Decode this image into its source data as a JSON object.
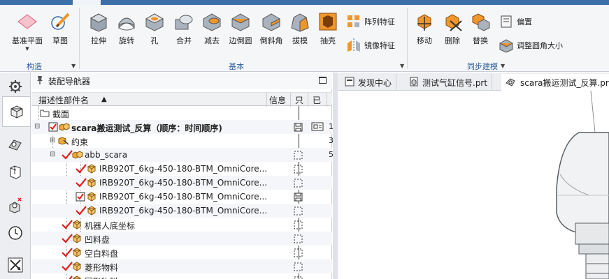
{
  "ribbon": {
    "groups": {
      "construct": "构造",
      "basic": "基本",
      "sync": "同步建模"
    },
    "buttons": {
      "datum_plane": "基准平面",
      "sketch": "草图",
      "extrude": "拉伸",
      "revolve": "旋转",
      "hole": "孔",
      "unite": "合并",
      "subtract": "减去",
      "edge_blend": "边倒圆",
      "chamfer": "倒斜角",
      "draft": "拔模",
      "shell": "抽壳",
      "pattern_feature": "阵列特征",
      "mirror_feature": "镜像特征",
      "move": "移动",
      "delete": "删除",
      "replace": "替换",
      "offset": "偏置",
      "resize_blend": "调整圆角大小"
    }
  },
  "navigator": {
    "title": "装配导航器",
    "columns": {
      "name": "描述性部件名",
      "sort_arrow": "▲",
      "info": "信息",
      "readonly": "只",
      "modified": "已"
    },
    "rows": [
      {
        "text": "截面",
        "bold": false,
        "icon": "folder-icon",
        "checked": null,
        "info": "",
        "col4": ""
      },
      {
        "text": "scara搬运测试_反算（顺序：时间顺序)",
        "bold": true,
        "icon": "assembly-icon",
        "checked": "box",
        "info": "save",
        "col3": "lock",
        "col4": "1"
      },
      {
        "text": "约束",
        "bold": false,
        "icon": "constraint-icon",
        "checked": null,
        "info": "",
        "col4": "3"
      },
      {
        "text": "abb_scara",
        "bold": false,
        "icon": "assembly-icon",
        "checked": "tick",
        "info": "dashed",
        "col4": "5"
      },
      {
        "text": "IRB920T_6kg-450-180-BTM_OmniCore...",
        "bold": false,
        "icon": "part-icon",
        "checked": "tick",
        "info": "dashed",
        "col4": ""
      },
      {
        "text": "IRB920T_6kg-450-180-BTM_OmniCore...",
        "bold": false,
        "icon": "part-icon",
        "checked": "tick",
        "info": "dashed",
        "col4": ""
      },
      {
        "text": "IRB920T_6kg-450-180-BTM_OmniCore...",
        "bold": false,
        "icon": "part-icon",
        "checked": "box",
        "info": "save",
        "col4": ""
      },
      {
        "text": "IRB920T_6kg-450-180-BTM_OmniCore...",
        "bold": false,
        "icon": "part-icon",
        "checked": "tick",
        "info": "dashed",
        "col4": ""
      },
      {
        "text": "机器人底坐标",
        "bold": false,
        "icon": "part-icon",
        "checked": "tick",
        "info": "dashed",
        "col4": ""
      },
      {
        "text": "凹料盘",
        "bold": false,
        "icon": "part-icon",
        "checked": "tick",
        "info": "dashed",
        "col4": ""
      },
      {
        "text": "空白料盘",
        "bold": false,
        "icon": "part-icon",
        "checked": "tick",
        "info": "dashed",
        "col4": ""
      },
      {
        "text": "菱形物料",
        "bold": false,
        "icon": "part-icon",
        "checked": "tick",
        "info": "dashed",
        "col4": ""
      },
      {
        "text": "圆形物料",
        "bold": false,
        "icon": "part-icon",
        "checked": "tick",
        "info": "dashed",
        "col4": ""
      }
    ]
  },
  "tabs": [
    {
      "label": "发现中心",
      "icon": "discovery-icon",
      "active": false
    },
    {
      "label": "测试气缸信号.prt",
      "icon": "part-file-icon",
      "active": false
    },
    {
      "label": "scara搬运测试_反算.prt",
      "icon": "assembly-file-icon",
      "active": true
    }
  ],
  "colors": {
    "accent": "#2a5d9f",
    "orange": "#f0962a",
    "check_red": "#e0201c"
  }
}
